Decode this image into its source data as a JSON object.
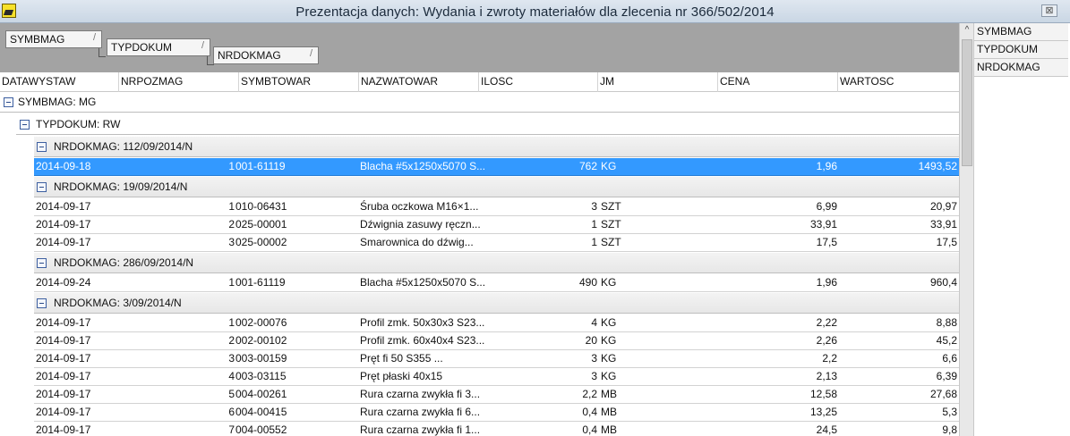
{
  "window": {
    "title": "Prezentacja danych: Wydania i zwroty materiałów dla zlecenia nr 366/502/2014",
    "close_glyph": "⊠"
  },
  "group_chips": [
    {
      "label": "SYMBMAG",
      "sort": "/"
    },
    {
      "label": "TYPDOKUM",
      "sort": "/"
    },
    {
      "label": "NRDOKMAG",
      "sort": "/"
    }
  ],
  "columns": [
    "DATAWYSTAW",
    "NRPOZMAG",
    "SYMBTOWAR",
    "NAZWATOWAR",
    "ILOSC",
    "JM",
    "CENA",
    "WARTOSC"
  ],
  "groups": {
    "level1": "SYMBMAG: MG",
    "level2": "TYPDOKUM: RW"
  },
  "documents": [
    {
      "label": "NRDOKMAG: 112/09/2014/N",
      "rows": [
        {
          "date": "2014-09-18",
          "nrpoz": "1",
          "symb": "001-61119",
          "name": "Blacha #5x1250x5070 S...",
          "ilosc": "762",
          "jm": "KG",
          "cena": "1,96",
          "wartosc": "1493,52",
          "selected": true
        }
      ]
    },
    {
      "label": "NRDOKMAG: 19/09/2014/N",
      "rows": [
        {
          "date": "2014-09-17",
          "nrpoz": "1",
          "symb": "010-06431",
          "name": "Śruba oczkowa M16×1...",
          "ilosc": "3",
          "jm": "SZT",
          "cena": "6,99",
          "wartosc": "20,97"
        },
        {
          "date": "2014-09-17",
          "nrpoz": "2",
          "symb": "025-00001",
          "name": "Dźwignia zasuwy ręczn...",
          "ilosc": "1",
          "jm": "SZT",
          "cena": "33,91",
          "wartosc": "33,91"
        },
        {
          "date": "2014-09-17",
          "nrpoz": "3",
          "symb": "025-00002",
          "name": "Smarownica do dźwig...",
          "ilosc": "1",
          "jm": "SZT",
          "cena": "17,5",
          "wartosc": "17,5"
        }
      ]
    },
    {
      "label": "NRDOKMAG: 286/09/2014/N",
      "rows": [
        {
          "date": "2014-09-24",
          "nrpoz": "1",
          "symb": "001-61119",
          "name": "Blacha #5x1250x5070 S...",
          "ilosc": "490",
          "jm": "KG",
          "cena": "1,96",
          "wartosc": "960,4"
        }
      ]
    },
    {
      "label": "NRDOKMAG: 3/09/2014/N",
      "rows": [
        {
          "date": "2014-09-17",
          "nrpoz": "1",
          "symb": "002-00076",
          "name": "Profil zmk. 50x30x3 S23...",
          "ilosc": "4",
          "jm": "KG",
          "cena": "2,22",
          "wartosc": "8,88"
        },
        {
          "date": "2014-09-17",
          "nrpoz": "2",
          "symb": "002-00102",
          "name": "Profil zmk. 60x40x4 S23...",
          "ilosc": "20",
          "jm": "KG",
          "cena": "2,26",
          "wartosc": "45,2"
        },
        {
          "date": "2014-09-17",
          "nrpoz": "3",
          "symb": "003-00159",
          "name": "Pręt fi 50  S355          ...",
          "ilosc": "3",
          "jm": "KG",
          "cena": "2,2",
          "wartosc": "6,6"
        },
        {
          "date": "2014-09-17",
          "nrpoz": "4",
          "symb": "003-03115",
          "name": "Pręt płaski 40x15",
          "ilosc": "3",
          "jm": "KG",
          "cena": "2,13",
          "wartosc": "6,39"
        },
        {
          "date": "2014-09-17",
          "nrpoz": "5",
          "symb": "004-00261",
          "name": "Rura czarna zwykła fi 3...",
          "ilosc": "2,2",
          "jm": "MB",
          "cena": "12,58",
          "wartosc": "27,68"
        },
        {
          "date": "2014-09-17",
          "nrpoz": "6",
          "symb": "004-00415",
          "name": "Rura czarna zwykła fi 6...",
          "ilosc": "0,4",
          "jm": "MB",
          "cena": "13,25",
          "wartosc": "5,3"
        },
        {
          "date": "2014-09-17",
          "nrpoz": "7",
          "symb": "004-00552",
          "name": "Rura czarna zwykła fi 1...",
          "ilosc": "0,4",
          "jm": "MB",
          "cena": "24,5",
          "wartosc": "9,8"
        }
      ]
    }
  ],
  "field_list": [
    "SYMBMAG",
    "TYPDOKUM",
    "NRDOKMAG"
  ],
  "scroll_up_glyph": "^",
  "colors": {
    "selection": "#3399ff",
    "group_area": "#a3a3a3"
  }
}
